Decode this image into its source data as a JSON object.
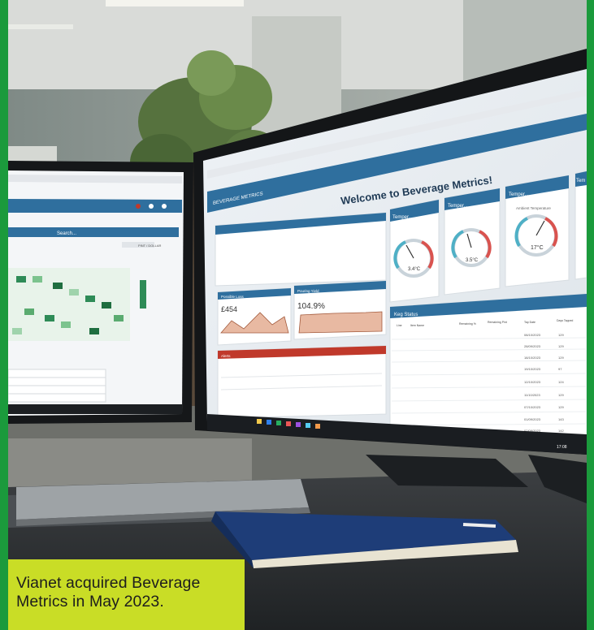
{
  "caption": {
    "text": "Vianet acquired Beverage Metrics in May 2023."
  },
  "colors": {
    "frame_green": "#1b9a3c",
    "caption_bg": "#c9dd26",
    "app_header_blue": "#2f6f9e",
    "alert_red": "#c0392b"
  },
  "right_monitor": {
    "app_logo": "BEVERAGE METRICS",
    "welcome_title": "Welcome to Beverage Metrics!",
    "panel_temper_1": "Temper...",
    "panel_temper_2": "Temper...",
    "panel_temper_3": "Temper...",
    "panel_temper_4": "Tem",
    "gauge_1_value": "3.4°C",
    "gauge_2_value": "3.5°C",
    "gauge_3_value": "17°C",
    "gauge_3_label": "Ambient Temperature",
    "panel_possible_loss": "Possible Loss",
    "possible_loss_value": "£454",
    "panel_pouring_yield": "Pouring Yield",
    "pouring_yield_value": "104.9%",
    "panel_keg_status": "Keg Status",
    "panel_alerts": "Alerts",
    "keg_headers": [
      "Line",
      "Item Name",
      "Remaining %",
      "Remaining Pint",
      "Tap Date",
      "Days Tapped"
    ],
    "keg_dates": [
      "08/10/2023",
      "28/09/2023",
      "18/10/2023",
      "19/10/2023",
      "12/10/2023",
      "11/10/2023",
      "07/10/2023",
      "01/09/2023",
      "02/09/2023"
    ],
    "keg_days": [
      "129",
      "129",
      "129",
      "97",
      "124",
      "129",
      "129",
      "143",
      "142"
    ],
    "taskbar_clock": "17:08"
  },
  "left_monitor": {
    "search_label": "Search...",
    "toggle_label": "PINT / DOLLAR"
  }
}
